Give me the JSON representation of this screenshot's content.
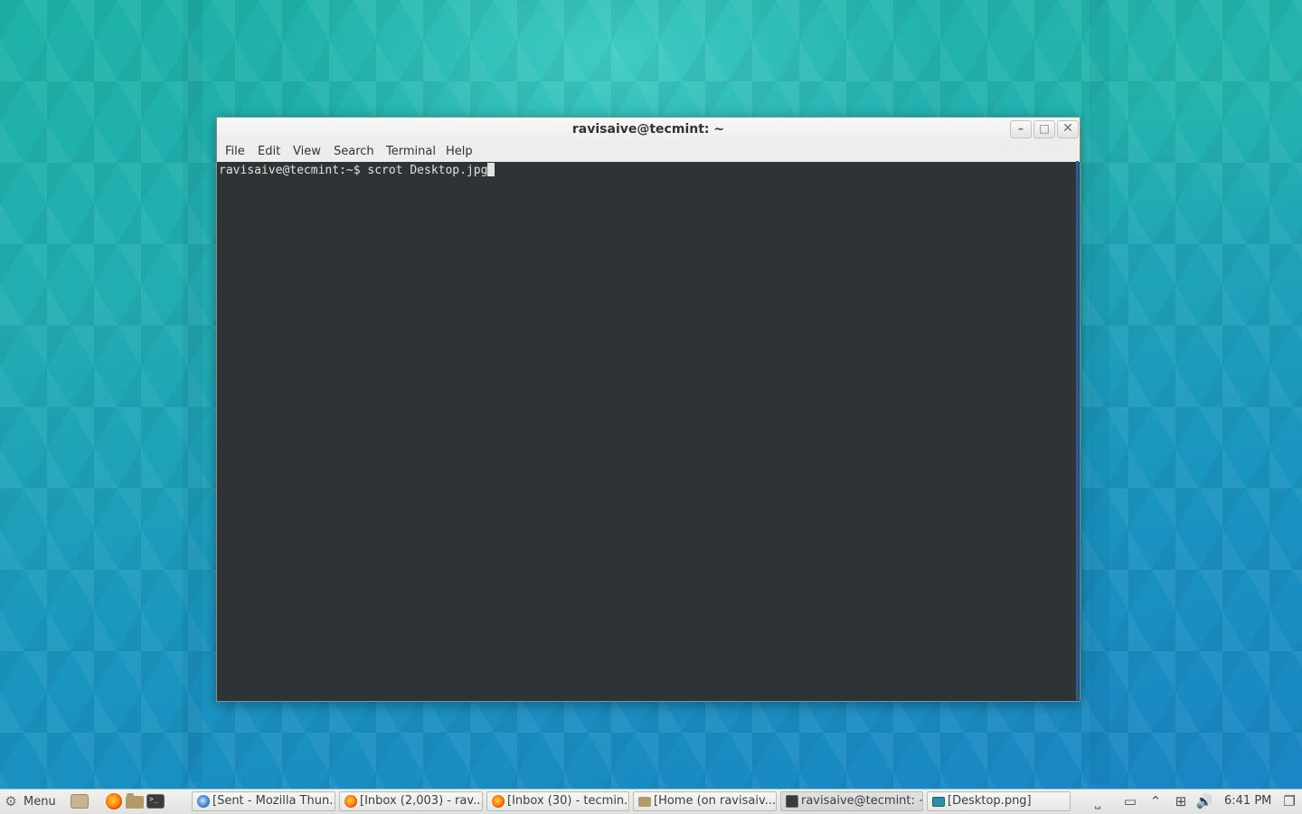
{
  "window": {
    "title": "ravisaive@tecmint: ~",
    "buttons": {
      "minimize": "–",
      "maximize": "□",
      "close": "✕"
    },
    "menu": [
      "File",
      "Edit",
      "View",
      "Search",
      "Terminal",
      "Help"
    ]
  },
  "terminal": {
    "prompt": "ravisaive@tecmint:~$",
    "command": "scrot Desktop.jpg"
  },
  "taskbar": {
    "menu_label": "Menu",
    "tasks": [
      {
        "label": "[Sent - Mozilla Thun...",
        "icon": "thunderbird-icon"
      },
      {
        "label": "[Inbox (2,003) - rav...",
        "icon": "firefox-icon"
      },
      {
        "label": "[Inbox (30) - tecmin...",
        "icon": "firefox-icon"
      },
      {
        "label": "[Home (on ravisaiv...",
        "icon": "folder-icon"
      },
      {
        "label": "ravisaive@tecmint: ~",
        "icon": "terminal-icon"
      },
      {
        "label": "[Desktop.png]",
        "icon": "image-viewer-icon"
      }
    ],
    "clock": "6:41 PM"
  }
}
